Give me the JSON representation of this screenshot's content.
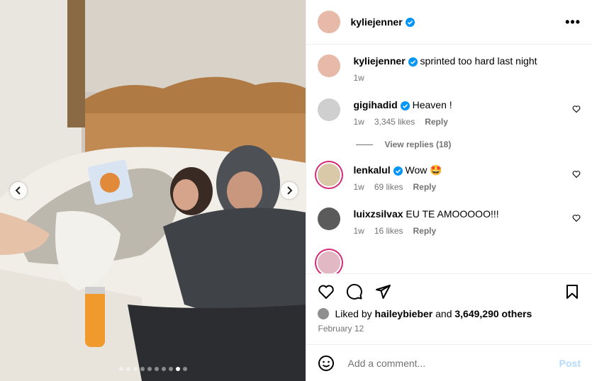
{
  "post": {
    "author": "kyliejenner",
    "caption": "sprinted too hard last night",
    "caption_time": "1w",
    "more_glyph": "•••"
  },
  "comments": [
    {
      "user": "gigihadid",
      "text": "Heaven !",
      "time": "1w",
      "likes": "3,345 likes",
      "reply": "Reply",
      "avatar_color": "#cfcfcf"
    },
    {
      "user": "lenkalul",
      "text": "Wow 🤩",
      "time": "1w",
      "likes": "69 likes",
      "reply": "Reply",
      "avatar_color": "#d9c9a8"
    },
    {
      "user": "luixzsilvax",
      "text": "EU TE AMOOOOO!!!",
      "time": "1w",
      "likes": "16 likes",
      "reply": "Reply",
      "avatar_color": "#5b5b5b"
    }
  ],
  "view_replies": "View replies (18)",
  "likes": {
    "liked_by_prefix": "Liked by",
    "liked_by_user": "haileybieber",
    "and_text": "and",
    "others": "3,649,290 others"
  },
  "date": "February 12",
  "add_comment": {
    "placeholder": "Add a comment...",
    "post_label": "Post"
  },
  "carousel": {
    "count": 10,
    "active": 9
  },
  "colors": {
    "verified": "#0095f6",
    "post_disabled": "#b3dbff",
    "muted": "#737373"
  }
}
